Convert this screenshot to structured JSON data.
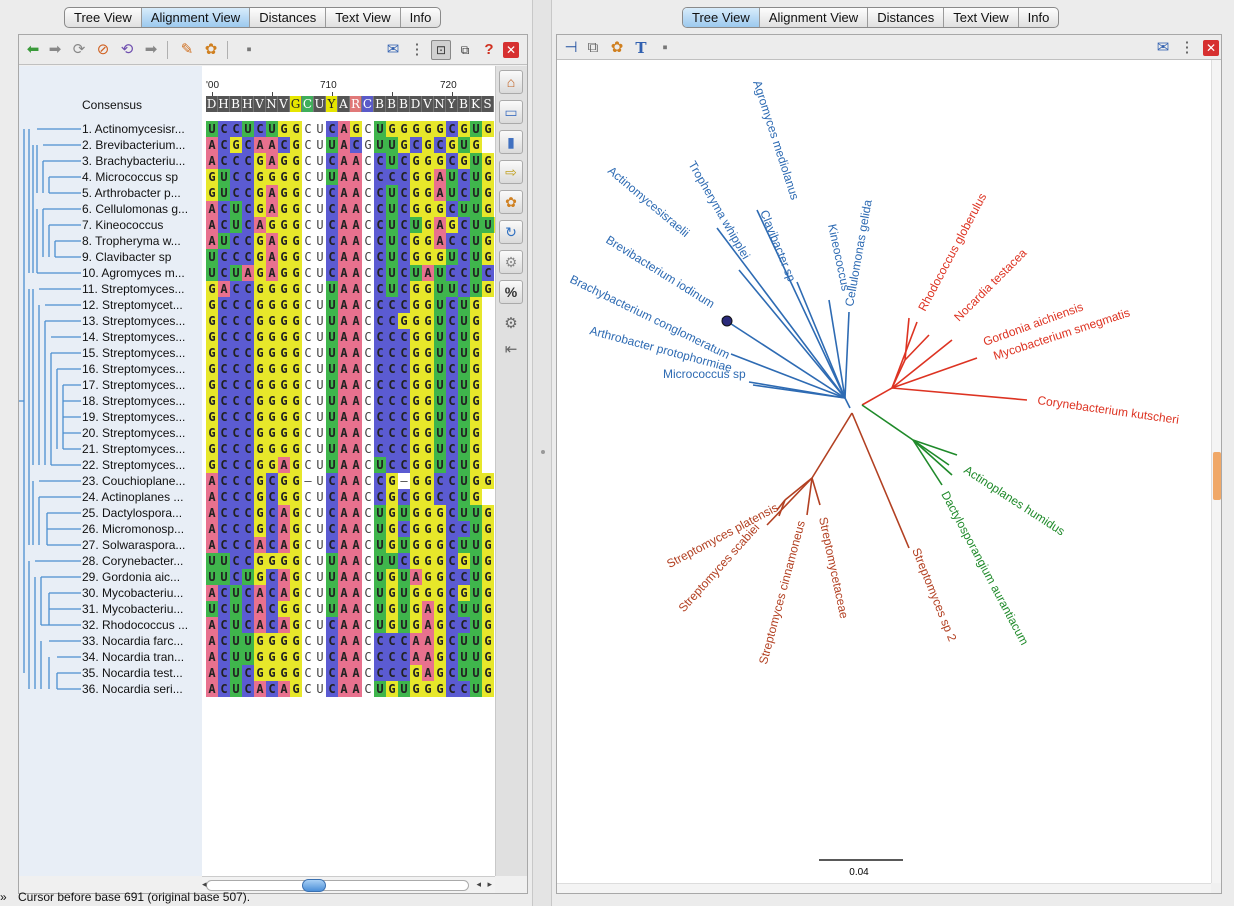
{
  "tabs": [
    "Tree View",
    "Alignment View",
    "Distances",
    "Text View",
    "Info"
  ],
  "left_active_tab": "Alignment View",
  "right_active_tab": "Tree View",
  "alignment": {
    "consensus_label": "Consensus",
    "ruler": [
      {
        "label": "'00",
        "col": 0
      },
      {
        "label": "710",
        "col": 10
      },
      {
        "label": "720",
        "col": 20
      }
    ],
    "consensus": "DHBHVNVGCUYARCBBBDVNYBKS",
    "sequence_names": [
      "1. Actinomycesisr...",
      "2. Brevibacterium...",
      "3. Brachybacteriu...",
      "4. Micrococcus sp",
      "5. Arthrobacter p...",
      "6. Cellulomonas g...",
      "7. Kineococcus",
      "8. Tropheryma w...",
      "9. Clavibacter sp",
      "10. Agromyces m...",
      "11. Streptomyces...",
      "12. Streptomycet...",
      "13. Streptomyces...",
      "14. Streptomyces...",
      "15. Streptomyces...",
      "16. Streptomyces...",
      "17. Streptomyces...",
      "18. Streptomyces...",
      "19. Streptomyces...",
      "20. Streptomyces...",
      "21. Streptomyces...",
      "22. Streptomyces...",
      "23. Couchioplane...",
      "24. Actinoplanes ...",
      "25. Dactylospora...",
      "26. Micromonosp...",
      "27. Solwarasporа...",
      "28. Corynebacter...",
      "29. Gordonia aic...",
      "30. Mycobacteriu...",
      "31. Mycobacteriu...",
      "32. Rhodococcus ...",
      "33. Nocardia farc...",
      "34. Nocardia tran...",
      "35. Nocardia test...",
      "36. Nocardia seri..."
    ],
    "sequences": [
      "UCCUCUGGCUCAGCUGGGGGCGUG",
      "ACGCAACGCUUACGUUGCGCGUG",
      "ACCCGAGGCUCAACCUCGGGCGUG",
      "GUCCGGGGCUUAACCCCGGAUCUG",
      "GUCCGAGGCUCAACCUCGGAUCUG",
      "ACUCGAGGCUCAACCUCGGGCUUG",
      "ACUCAGGGCUCAACCUCUGAGCUUG",
      "AUCCGAGGCUCAACCUCGGACCUG",
      "UCCCGAGGCUCAACCUCGGGUCUG",
      "UCUAGAGGCUCAACCUCUAUCCUC",
      "GACCGGGGCUUAACCUCGGUUCUG",
      "GCCCGGGGCUUAACCCCGGUCUG",
      "GCCCGGGGCUUAACCCGGGUCUG",
      "GCCCGGGGCUUAACCCCGGUCUG",
      "GCCCGGGGCUUAACCCCGGUCUG",
      "GCCCGGGGCUUAACCCCGGUCUG",
      "GCCCGGGGCUUAACCCCGGUCUG",
      "GCCCGGGGCUUAACCCCGGUCUG",
      "GCCCGGGGCUUAACCCCGGUCUG",
      "GCCCGGGGCUUAACCCCGGUCUG",
      "GCCCGGGGCUUAACCCCGGUCUG",
      "GCCCGGAGCUUAACUCCGGUCUG",
      "ACCCGCGG-UCAACCG-GGCCUGG",
      "ACCCGCGGCUCAACCGCGGCCUG",
      "ACCCGCAGCUCAACUGUGGGCUUG",
      "ACCCGCAGCUCAACUGCGGGCCUG",
      "ACCCACAGCUCAACUGUGGGCUUG",
      "UUCCGGGGCUUAACUUCGGGCGUG",
      "UUCUGCAGCUUAACUGUAGGCCUG",
      "ACUCACAGCUUAACUGUGGGCGUG",
      "UCUCACGGCUUAACUGUGAGCUUG",
      "ACUCACAGCUCAACUGUGAGCCUG",
      "ACUUGGGGCUCAACCCCAAGCUUG",
      "ACUUGGGGCUCAACCCCAAGCUUG",
      "ACUCGGGGCUCAACCCCGAGCUUG",
      "ACUCACAGCUCAACUGUGGGCCUG"
    ]
  },
  "status_text": "Cursor before base 691 (original base 507).",
  "status_marker": "»",
  "tree": {
    "scale_label": "0.04",
    "blue_color": "#2e6bb3",
    "red_color": "#dd3322",
    "brown_color": "#b24022",
    "green_color": "#1f8a2a",
    "blue_taxa": [
      "Agromyces mediolanus",
      "Tropheryma whipplei",
      "Clavibacter sp",
      "Kineococcus",
      "Cellulomonas gelida",
      "Actinomycesisraelii",
      "Brevibacterium iodinum",
      "Brachybacterium conglomeratum",
      "Arthrobacter protophormiae",
      "Micrococcus sp"
    ],
    "red_taxa": [
      "Rhodococcus globerulus",
      "Nocardia testacea",
      "Gordonia aichiensis",
      "Mycobacterium smegmatis",
      "Corynebacterium kutscheri"
    ],
    "brown_taxa": [
      "Streptomyces platensis",
      "Streptomyces scabiei",
      "Streptomyces cinnamoneus",
      "Streptomycetaceae",
      "Streptomyces sp 2"
    ],
    "green_taxa": [
      "Actinoplanes humidus",
      "Dactylosporangium aurantiacum"
    ]
  }
}
